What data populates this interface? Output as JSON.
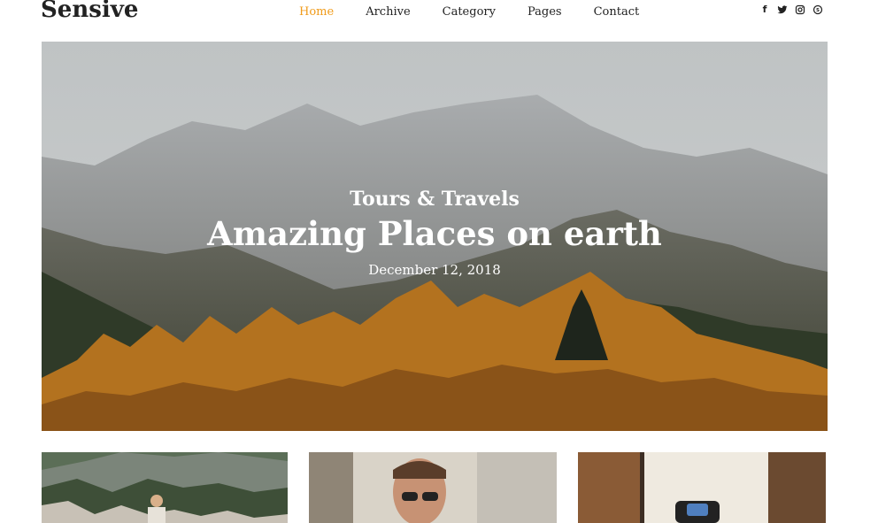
{
  "brand": {
    "logo": "Sensive"
  },
  "nav": {
    "items": [
      {
        "label": "Home",
        "active": true
      },
      {
        "label": "Archive"
      },
      {
        "label": "Category"
      },
      {
        "label": "Pages"
      },
      {
        "label": "Contact"
      }
    ],
    "accent_color": "#f09b1a"
  },
  "social": {
    "icons": [
      "facebook-icon",
      "twitter-icon",
      "instagram-icon",
      "skype-icon"
    ]
  },
  "hero": {
    "category": "Tours & Travels",
    "title": "Amazing Places on earth",
    "date": "December 12, 2018"
  },
  "cards": [
    {
      "image": "mountain-hiker"
    },
    {
      "image": "man-with-glasses"
    },
    {
      "image": "wristwatch"
    }
  ]
}
